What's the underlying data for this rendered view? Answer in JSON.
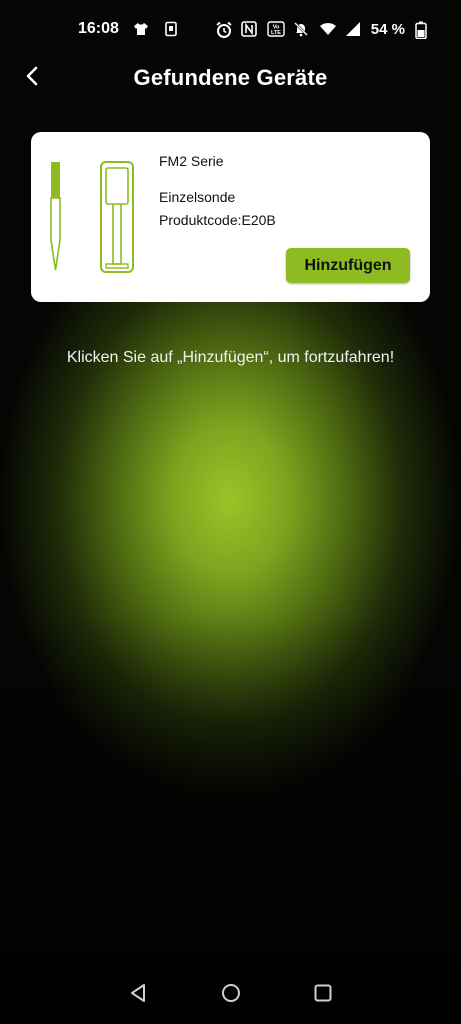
{
  "status_bar": {
    "time": "16:08",
    "battery": "54 %",
    "icons": [
      "shirt-icon",
      "sim-icon",
      "alarm-icon",
      "nfc-icon",
      "volte-icon",
      "mute-icon",
      "wifi-icon",
      "signal-icon",
      "battery-icon"
    ]
  },
  "header": {
    "title": "Gefundene Geräte",
    "back_icon": "chevron-left-icon"
  },
  "device_card": {
    "series": "FM2 Serie",
    "type": "Einzelsonde",
    "product_code": "Produktcode:E20B",
    "add_label": "Hinzufügen",
    "icons": [
      "probe-icon",
      "repeater-icon"
    ]
  },
  "hint": "Klicken Sie auf „Hinzufügen“, um fortzufahren!",
  "nav_bar": {
    "icons": [
      "back-triangle-icon",
      "home-circle-icon",
      "recents-square-icon"
    ]
  },
  "colors": {
    "accent": "#8dbb21",
    "background_glow": "#9bc428",
    "background_dark": "#000000",
    "card": "#ffffff"
  }
}
